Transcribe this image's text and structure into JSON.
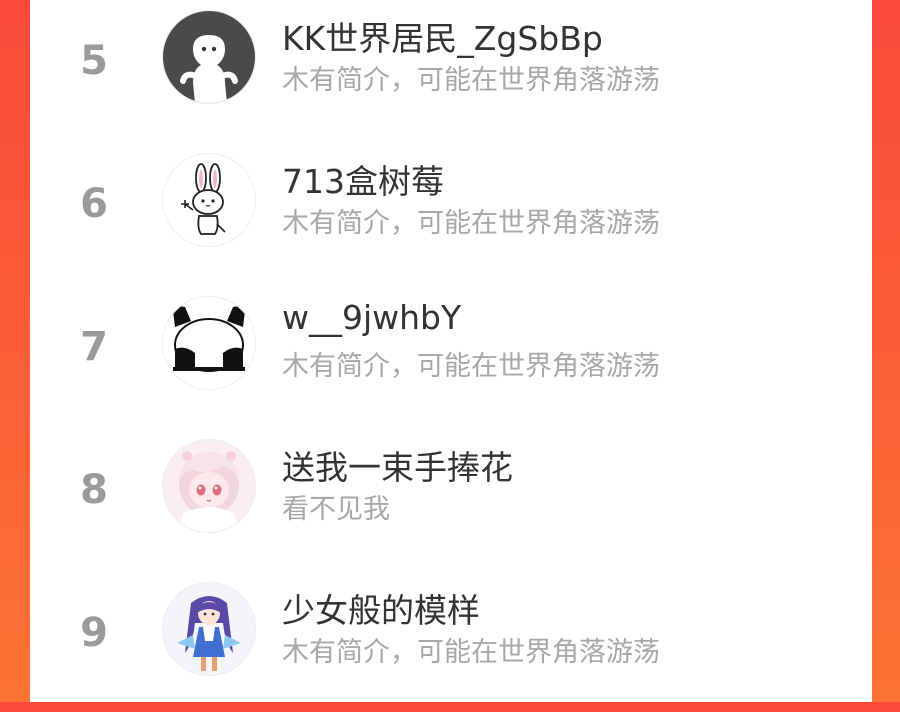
{
  "ranking": {
    "rows": [
      {
        "rank": "5",
        "name": "KK世界居民_ZgSbBp",
        "bio": "木有简介，可能在世界角落游荡",
        "avatar_icon": "ghost-avatar-icon"
      },
      {
        "rank": "6",
        "name": "713盒树莓",
        "bio": "木有简介，可能在世界角落游荡",
        "avatar_icon": "bunny-avatar-icon"
      },
      {
        "rank": "7",
        "name": "w__9jwhbY",
        "bio": "木有简介，可能在世界角落游荡",
        "avatar_icon": "panda-avatar-icon"
      },
      {
        "rank": "8",
        "name": "送我一束手捧花",
        "bio": "看不见我",
        "avatar_icon": "anime-pink-girl-avatar-icon"
      },
      {
        "rank": "9",
        "name": "少女般的模样",
        "bio": "木有简介，可能在世界角落游荡",
        "avatar_icon": "anime-blue-girl-avatar-icon"
      }
    ]
  },
  "colors": {
    "background_gradient_top": "#fa4a3b",
    "background_gradient_bottom": "#fc7434",
    "card": "#ffffff",
    "rank_text": "#9a9a9a",
    "name_text": "#333333",
    "bio_text": "#a8a8a8"
  }
}
